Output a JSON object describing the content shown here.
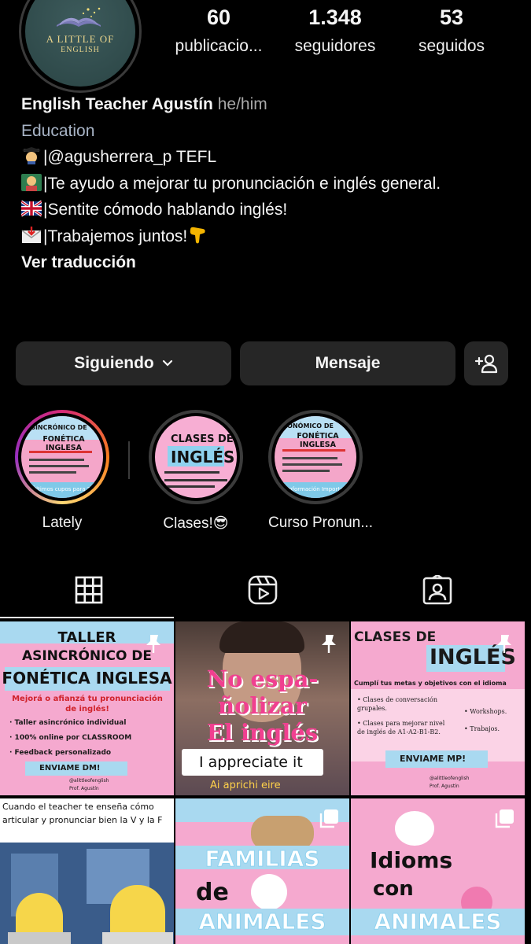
{
  "profile": {
    "avatar_text_line1": "A LITTLE OF",
    "avatar_text_line2": "ENGLISH",
    "stats": [
      {
        "value": "60",
        "label": "publicacio..."
      },
      {
        "value": "1.348",
        "label": "seguidores"
      },
      {
        "value": "53",
        "label": "seguidos"
      }
    ],
    "name": "English Teacher Agustín",
    "pronouns": "he/him",
    "category": "Education",
    "bio_lines": [
      {
        "emoji": "graduate-emoji",
        "text": "|@agusherrera_p TEFL"
      },
      {
        "emoji": "teacher-emoji",
        "text": "|Te ayudo a mejorar tu pronunciación e inglés general."
      },
      {
        "emoji": "uk-flag-emoji",
        "text": "|Sentite cómodo hablando inglés!"
      },
      {
        "emoji": "envelope-emoji",
        "text": "|Trabajemos juntos!"
      }
    ],
    "bio_trailing_emoji": "pointing-down-emoji",
    "translate_label": "Ver traducción"
  },
  "actions": {
    "follow_label": "Siguiendo",
    "message_label": "Mensaje",
    "add_icon": "add-person-icon"
  },
  "highlights": [
    {
      "label": "Lately",
      "line1": "ASINCRÓNICO DE",
      "line2": "FONÉTICA INGLESA",
      "foot": "Últimos cupos para 2024"
    },
    {
      "label": "Clases!😎",
      "line1": "CLASES DE",
      "line2": "INGLÉS"
    },
    {
      "label": "Curso Pronun...",
      "line1": "RONÓMICO DE",
      "line2": "FONÉTICA INGLESA",
      "foot": "Información Importante"
    }
  ],
  "tabs": [
    {
      "icon": "grid-icon",
      "active": true
    },
    {
      "icon": "reels-icon",
      "active": false
    },
    {
      "icon": "tagged-icon",
      "active": false
    }
  ],
  "posts": {
    "p1": {
      "t1": "TALLER",
      "t2": "ASINCRÓNICO DE",
      "t3": "FONÉTICA INGLESA",
      "sub": "Mejorá o afianzá tu pronunciación de inglés!",
      "b1": "· Taller asincrónico individual",
      "b2": "· 100% online por CLASSROOM",
      "b3": "· Feedback personalizado",
      "cta": "ENVIAME DM!",
      "handle": "@alittleofenglish",
      "sign": "Prof. Agustín"
    },
    "p2": {
      "t1": "No espa-",
      "t2": "ñolizar",
      "t3": "El inglés",
      "caption": "I appreciate it",
      "sub": "Ai aprichi eire"
    },
    "p3": {
      "t1": "CLASES DE",
      "t2": "INGLÉS",
      "sub": "Cumplí tus metas y objetivos con el idioma",
      "b1": "• Clases de conversación grupales.",
      "b2": "• Clases para mejorar nivel de inglés de A1-A2-B1-B2.",
      "r1": "• Workshops.",
      "r2": "• Trabajos.",
      "cta": "ENVIAME MP!",
      "handle": "@alittleofenglish",
      "sign": "Prof. Agustín"
    },
    "p4": {
      "caption": "Cuando el teacher te enseña cómo articular y pronunciar bien la V y la F"
    },
    "p5": {
      "w1": "FAMILIAS",
      "w2": "de",
      "w3": "ANIMALES"
    },
    "p6": {
      "w1": "Idioms",
      "w2": "con",
      "w3": "ANIMALES"
    }
  },
  "colors": {
    "background": "#000000",
    "button_bg": "#262626",
    "post_pink": "#f5a9cf",
    "post_blue": "#a9d9f0",
    "story_ring": [
      "#d62976",
      "#fa7e1e",
      "#feda75",
      "#962fbf"
    ]
  }
}
